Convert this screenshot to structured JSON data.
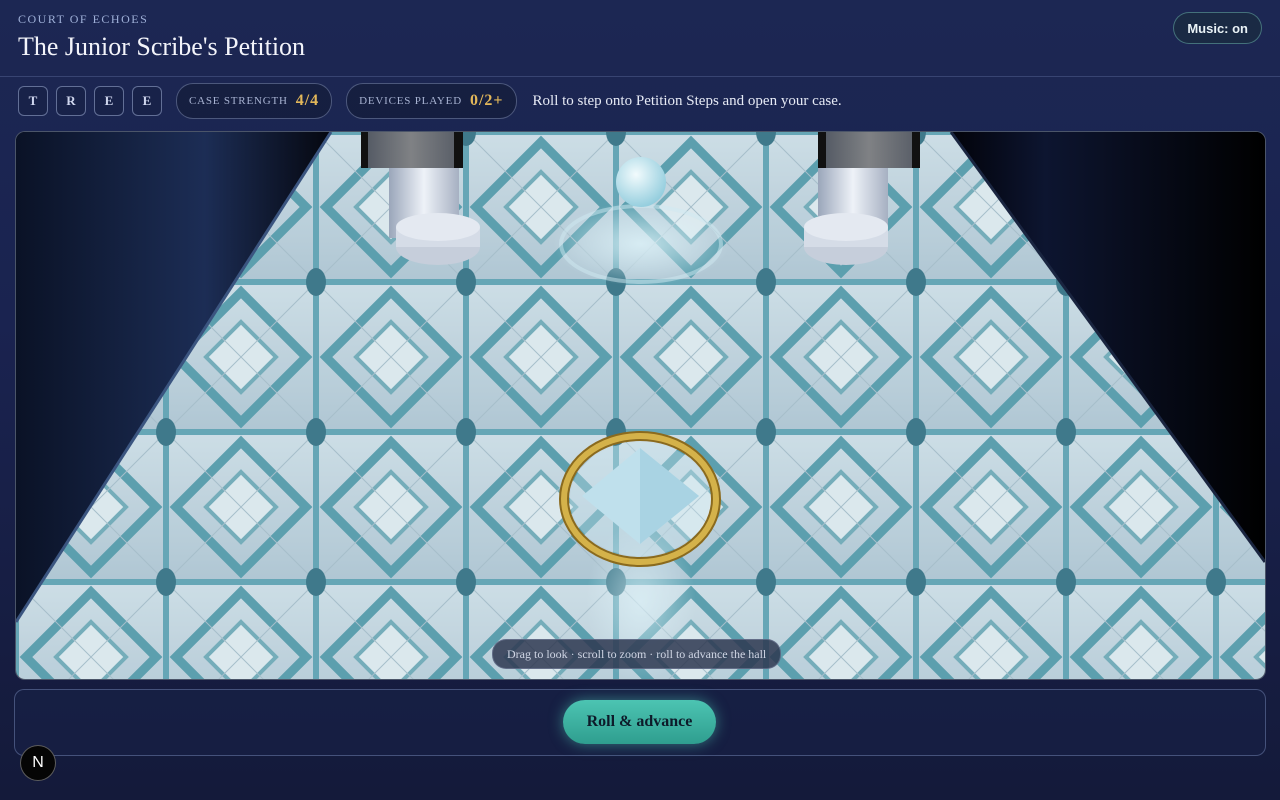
{
  "header": {
    "subtitle": "COURT OF ECHOES",
    "title": "The Junior Scribe's Petition",
    "music_label": "Music: on"
  },
  "status": {
    "letters": [
      "T",
      "R",
      "E",
      "E"
    ],
    "case_strength_label": "CASE STRENGTH",
    "case_strength_value": "4/4",
    "devices_played_label": "DEVICES PLAYED",
    "devices_played_value": "0/2+",
    "message": "Roll to step onto Petition Steps and open your case."
  },
  "scene": {
    "hint": "Drag to look · scroll to zoom · roll to advance the hall",
    "colors": {
      "marble": "#b9cfdb",
      "inlay": "#3f8ea3",
      "ring": "#c9a740",
      "orb": "#bfe6f0"
    }
  },
  "actions": {
    "roll_label": "Roll & advance"
  },
  "badge": {
    "label": "N"
  }
}
